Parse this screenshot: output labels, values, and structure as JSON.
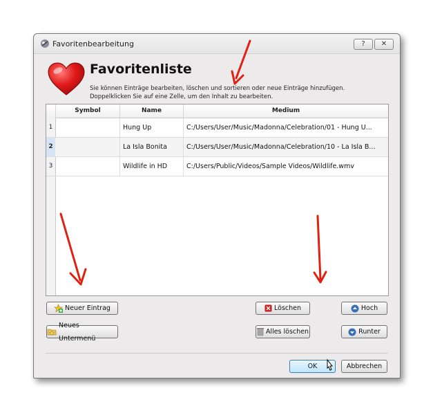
{
  "window": {
    "title": "Favoritenbearbeitung",
    "help_label": "?",
    "close_label": "✕"
  },
  "header": {
    "heading": "Favoritenliste",
    "line1": "Sie können Einträge bearbeiten, löschen und sortieren oder neue Einträge hinzufügen.",
    "line2": "Doppelklicken Sie auf eine Zelle, um den Inhalt zu bearbeiten."
  },
  "table": {
    "columns": [
      "Symbol",
      "Name",
      "Medium"
    ],
    "rows": [
      {
        "num": "1",
        "symbol": "",
        "name": "Hung Up",
        "medium": "C:/Users/User/Music/Madonna/Celebration/01 - Hung U..."
      },
      {
        "num": "2",
        "symbol": "",
        "name": "La Isla Bonita",
        "medium": "C:/Users/User/Music/Madonna/Celebration/10 - La Isla B..."
      },
      {
        "num": "3",
        "symbol": "",
        "name": "Wildlife in HD",
        "medium": "C:/Users/Public/Videos/Sample Videos/Wildlife.wmv"
      }
    ],
    "selected_row": 2
  },
  "buttons": {
    "new_entry": "Neuer Eintrag",
    "new_submenu": "Neues Untermenü",
    "delete": "Löschen",
    "delete_all": "Alles löschen",
    "up": "Hoch",
    "down": "Runter",
    "ok": "OK",
    "cancel": "Abbrechen"
  },
  "icons": {
    "app": "app-icon",
    "heart": "heart-icon",
    "new_entry": "add-star-icon",
    "new_submenu": "folder-star-icon",
    "delete": "delete-x-icon",
    "delete_all": "trash-icon",
    "up": "arrow-up-icon",
    "down": "arrow-down-icon"
  },
  "colors": {
    "heart": "#d01818",
    "annotation_arrow": "#e02010",
    "ok_button": "#bee6fd",
    "selected_row_header": "#d6e4f5"
  }
}
